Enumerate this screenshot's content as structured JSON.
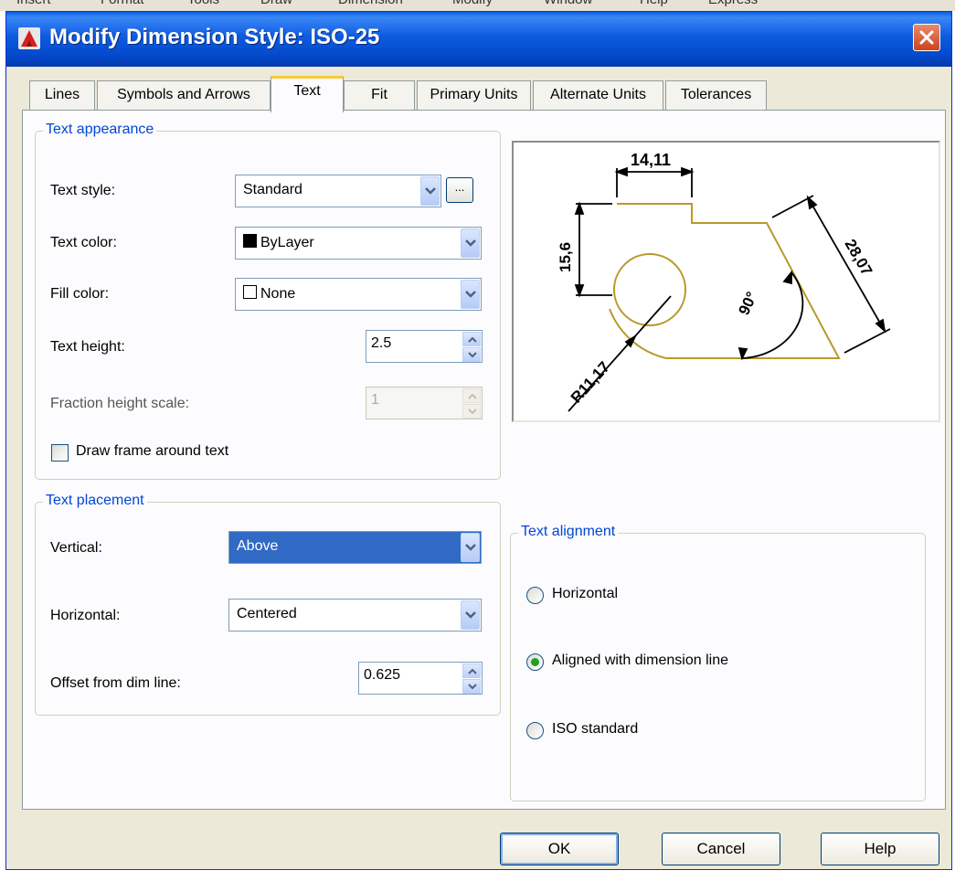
{
  "window": {
    "title": "Modify Dimension Style: ISO-25",
    "background_menu": [
      "Insert",
      "Format",
      "Tools",
      "Draw",
      "Dimension",
      "Modify",
      "Window",
      "Help",
      "Express"
    ]
  },
  "tabs": [
    {
      "label": "Lines",
      "active": false
    },
    {
      "label": "Symbols and Arrows",
      "active": false
    },
    {
      "label": "Text",
      "active": true
    },
    {
      "label": "Fit",
      "active": false
    },
    {
      "label": "Primary Units",
      "active": false
    },
    {
      "label": "Alternate Units",
      "active": false
    },
    {
      "label": "Tolerances",
      "active": false
    }
  ],
  "text_appearance": {
    "title": "Text appearance",
    "text_style": {
      "label": "Text style:",
      "value": "Standard",
      "browse_label": "..."
    },
    "text_color": {
      "label": "Text color:",
      "value": "ByLayer",
      "swatch": "#000000"
    },
    "fill_color": {
      "label": "Fill color:",
      "value": "None",
      "swatch": "#ffffff"
    },
    "text_height": {
      "label": "Text height:",
      "value": "2.5"
    },
    "fraction_height_scale": {
      "label": "Fraction height scale:",
      "value": "1",
      "enabled": false
    },
    "draw_frame": {
      "label": "Draw frame around text",
      "checked": false
    }
  },
  "text_placement": {
    "title": "Text placement",
    "vertical": {
      "label": "Vertical:",
      "value": "Above"
    },
    "horizontal": {
      "label": "Horizontal:",
      "value": "Centered"
    },
    "offset": {
      "label": "Offset from dim line:",
      "value": "0.625"
    }
  },
  "text_alignment": {
    "title": "Text alignment",
    "options": [
      {
        "label": "Horizontal",
        "selected": false
      },
      {
        "label": "Aligned with dimension line",
        "selected": true
      },
      {
        "label": "ISO standard",
        "selected": false
      }
    ]
  },
  "preview": {
    "dim_top": "14,11",
    "dim_left": "15,6",
    "dim_right": "28,07",
    "dim_angle": "90°",
    "dim_radius": "R11,17",
    "geometry_color": "#b79a2a"
  },
  "buttons": {
    "ok": "OK",
    "cancel": "Cancel",
    "help": "Help"
  },
  "colors": {
    "title_bar": "#0a5ee4",
    "group_title": "#0046d5",
    "selection": "#316ac5",
    "radio_selected": "#21a121"
  }
}
